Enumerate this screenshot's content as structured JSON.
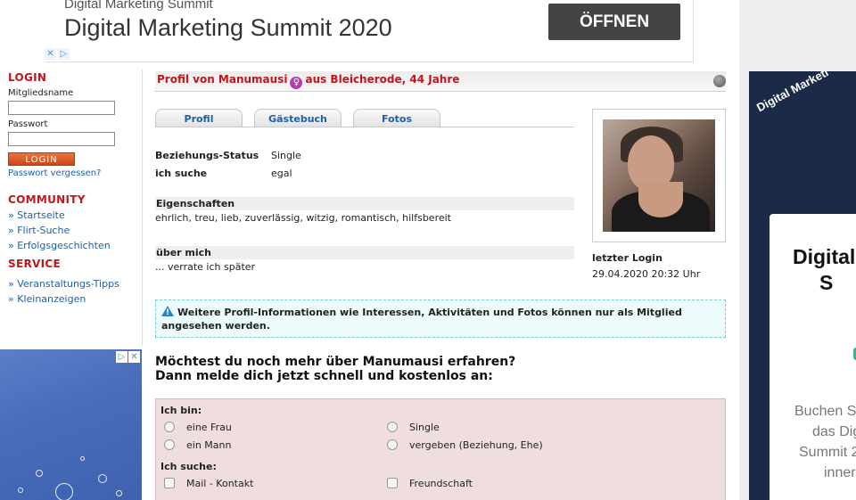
{
  "top_ad": {
    "subtitle": "Digital Marketing Summit",
    "title": "Digital Marketing Summit 2020",
    "button": "ÖFFNEN",
    "marks": [
      "✕",
      "▷"
    ]
  },
  "sidebar": {
    "login_heading": "LOGIN",
    "member_label": "Mitgliedsname",
    "password_label": "Passwort",
    "login_button": "LOGIN",
    "forgot_link": "Passwort vergessen?",
    "community_heading": "COMMUNITY",
    "community_items": [
      "» Startseite",
      "» Flirt-Suche",
      "» Erfolgsgeschichten"
    ],
    "service_heading": "SERVICE",
    "service_items": [
      "» Veranstaltungs-Tipps",
      "» Kleinanzeigen"
    ]
  },
  "left_ad": {
    "marks": [
      "▷",
      "✕"
    ]
  },
  "profile": {
    "title_prefix": "Profil von Manumausi",
    "title_suffix": "aus Bleicherode, 44 Jahre",
    "gender_icon": "♀",
    "tabs": [
      "Profil",
      "Gästebuch",
      "Fotos"
    ],
    "relationship_label": "Beziehungs-Status",
    "relationship_value": "Single",
    "seeking_label": "ich suche",
    "seeking_value": "egal",
    "traits_heading": "Eigenschaften",
    "traits_value": "ehrlich, treu, lieb, zuverlässig, witzig, romantisch, hilfsbereit",
    "about_heading": "über mich",
    "about_value": "... verrate ich später",
    "last_login_label": "letzter Login",
    "last_login_value": "29.04.2020 20:32 Uhr"
  },
  "notice": "Weitere Profil-Informationen wie Interessen, Aktivitäten und Fotos können nur als Mitglied angesehen werden.",
  "cta": {
    "line1": "Möchtest du noch mehr über Manumausi erfahren?",
    "line2": "Dann melde dich jetzt schnell und kostenlos an:"
  },
  "form": {
    "iam_heading": "Ich bin:",
    "iam_left": [
      "eine Frau",
      "ein Mann"
    ],
    "iam_right": [
      "Single",
      "vergeben (Beziehung, Ehe)"
    ],
    "seek_heading": "Ich suche:",
    "seek_left": [
      "Mail - Kontakt"
    ],
    "seek_right": [
      "Freundschaft"
    ]
  },
  "right_ad": {
    "diagonal": "Digital Marketi",
    "card_title_1": "Digital",
    "card_title_2": "S",
    "card_desc": [
      "Buchen S",
      "das Dig",
      "Summit 2",
      "inner"
    ]
  }
}
